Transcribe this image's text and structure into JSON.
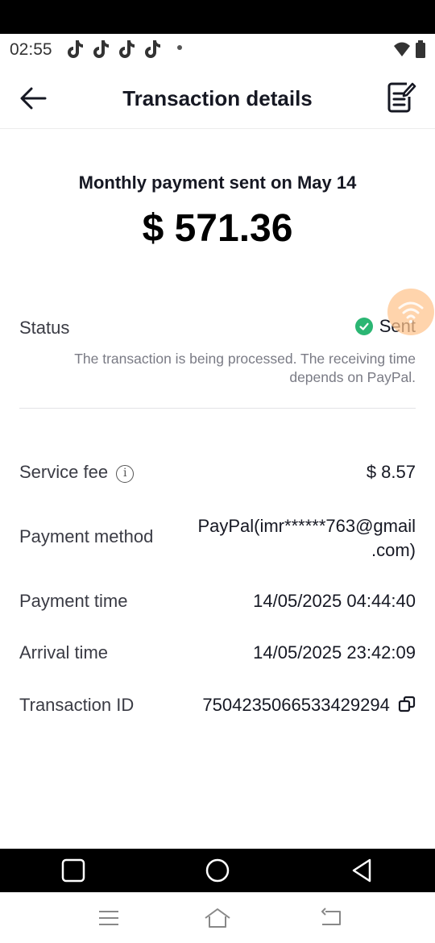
{
  "status_bar": {
    "time": "02:55",
    "app_icons": [
      "tiktok-icon",
      "tiktok-icon",
      "tiktok-icon",
      "tiktok-icon"
    ]
  },
  "header": {
    "title": "Transaction details"
  },
  "summary": {
    "title": "Monthly payment sent on May 14",
    "amount": "$ 571.36"
  },
  "status": {
    "label": "Status",
    "value": "Sent",
    "note": "The transaction is being processed. The receiving time depends on PayPal.",
    "color": "#2bb673"
  },
  "details": {
    "service_fee_label": "Service fee",
    "service_fee_value": "$ 8.57",
    "payment_method_label": "Payment method",
    "payment_method_line1": "PayPal(imr******763@gmail",
    "payment_method_line2": ".com)",
    "payment_time_label": "Payment time",
    "payment_time_value": "14/05/2025 04:44:40",
    "arrival_time_label": "Arrival time",
    "arrival_time_value": "14/05/2025 23:42:09",
    "transaction_id_label": "Transaction ID",
    "transaction_id_value": "7504235066533429294"
  },
  "colors": {
    "text_primary": "#161823",
    "text_secondary": "#7a7b85",
    "success": "#2bb673",
    "floating_bubble": "#ffc48c"
  }
}
